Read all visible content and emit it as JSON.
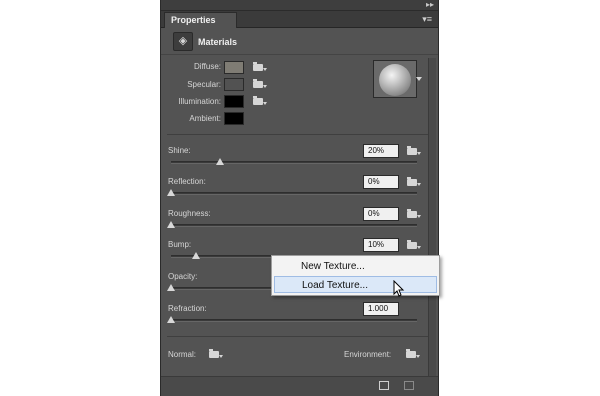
{
  "panel": {
    "tab": "Properties",
    "title": "Materials",
    "collapse_icon": "double-arrow-icon",
    "menu_icon": "panel-menu-icon"
  },
  "materials": {
    "diffuse": {
      "label": "Diffuse:",
      "color": "#7f7c74"
    },
    "specular": {
      "label": "Specular:",
      "color": "#525252"
    },
    "illumination": {
      "label": "Illumination:",
      "color": "#000000"
    },
    "ambient": {
      "label": "Ambient:",
      "color": "#000000"
    }
  },
  "sliders": [
    {
      "key": "shine",
      "label": "Shine:",
      "value": "20%",
      "level": 0.2
    },
    {
      "key": "reflection",
      "label": "Reflection:",
      "value": "0%",
      "level": 0.0
    },
    {
      "key": "roughness",
      "label": "Roughness:",
      "value": "0%",
      "level": 0.0
    },
    {
      "key": "bump",
      "label": "Bump:",
      "value": "10%",
      "level": 0.1
    },
    {
      "key": "opacity",
      "label": "Opacity:",
      "value": "",
      "level": 0.0
    },
    {
      "key": "refraction",
      "label": "Refraction:",
      "value": "1.000",
      "level": 0.0
    }
  ],
  "bottom": {
    "normal": "Normal:",
    "environment": "Environment:"
  },
  "context_menu": {
    "items": [
      "New Texture...",
      "Load Texture..."
    ],
    "highlighted": "Load Texture..."
  }
}
